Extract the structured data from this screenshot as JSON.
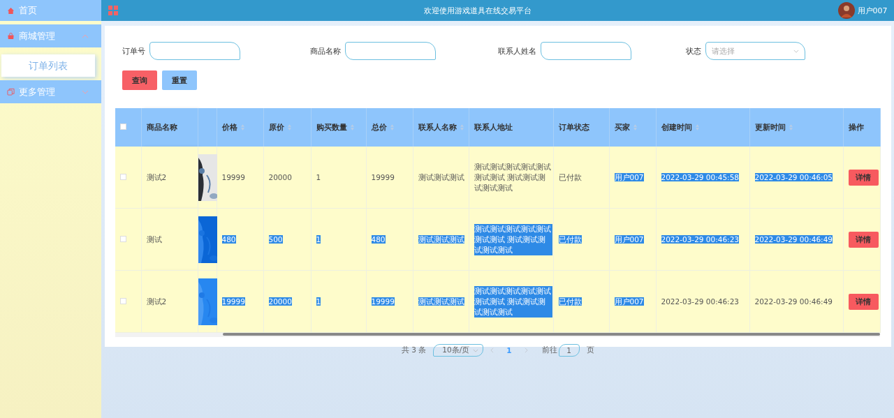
{
  "sidebar": {
    "items": [
      {
        "label": "首页",
        "kind": "home"
      },
      {
        "label": "商城管理",
        "kind": "shop",
        "expanded": true,
        "children": [
          {
            "label": "订单列表",
            "selected": true
          }
        ]
      },
      {
        "label": "更多管理",
        "kind": "more",
        "expanded": false
      }
    ]
  },
  "header": {
    "title": "欢迎使用游戏道具在线交易平台",
    "user": "用户007"
  },
  "filters": [
    {
      "label": "订单号",
      "kind": "input"
    },
    {
      "label": "商品名称",
      "kind": "input"
    },
    {
      "label": "联系人姓名",
      "kind": "input"
    },
    {
      "label": "状态",
      "kind": "select",
      "placeholder": "请选择"
    }
  ],
  "buttons": [
    {
      "label": "查询",
      "kind": "search"
    },
    {
      "label": "重置",
      "kind": "reset"
    }
  ],
  "table": {
    "all_checked": false,
    "columns": [
      {
        "label": "商品名称",
        "sortable": false
      },
      {
        "label": "价格",
        "sortable": true
      },
      {
        "label": "原价",
        "sortable": true
      },
      {
        "label": "购买数量",
        "sortable": true
      },
      {
        "label": "总价",
        "sortable": true
      },
      {
        "label": "联系人名称",
        "sortable": true
      },
      {
        "label": "联系人地址",
        "sortable": false
      },
      {
        "label": "订单状态",
        "sortable": false
      },
      {
        "label": "买家",
        "sortable": true
      },
      {
        "label": "创建时间",
        "sortable": true
      },
      {
        "label": "更新时间",
        "sortable": true
      },
      {
        "label": "操作",
        "sortable": false
      }
    ],
    "rows": [
      {
        "checked": false,
        "action": "详情",
        "cells": [
          {
            "text": "测试2",
            "highlighted": false
          },
          {
            "text": "19999",
            "highlighted": false
          },
          {
            "text": "20000",
            "highlighted": false
          },
          {
            "text": "1",
            "highlighted": false
          },
          {
            "text": "19999",
            "highlighted": false
          },
          {
            "text": "测试测试测试",
            "highlighted": false
          },
          {
            "text": "测试测试测试测试测试测试测试 测试测试测试测试测试",
            "highlighted": false
          },
          {
            "text": "已付款",
            "highlighted": false
          },
          {
            "text": "用户007",
            "highlighted": true
          },
          {
            "text": "2022-03-29 00:45:58",
            "highlighted": true
          },
          {
            "text": "2022-03-29 00:46:05",
            "highlighted": true
          }
        ]
      },
      {
        "checked": false,
        "action": "详情",
        "cells": [
          {
            "text": "测试",
            "highlighted": false
          },
          {
            "text": "480",
            "highlighted": true
          },
          {
            "text": "500",
            "highlighted": true
          },
          {
            "text": "1",
            "highlighted": true
          },
          {
            "text": "480",
            "highlighted": true
          },
          {
            "text": "测试测试测试",
            "highlighted": true
          },
          {
            "text": "测试测试测试测试测试测试测试 测试测试测试测试测试",
            "highlighted": true
          },
          {
            "text": "已付款",
            "highlighted": true
          },
          {
            "text": "用户007",
            "highlighted": true
          },
          {
            "text": "2022-03-29 00:46:23",
            "highlighted": true
          },
          {
            "text": "2022-03-29 00:46:49",
            "highlighted": true
          }
        ]
      },
      {
        "checked": false,
        "action": "详情",
        "cells": [
          {
            "text": "测试2",
            "highlighted": false
          },
          {
            "text": "19999",
            "highlighted": true
          },
          {
            "text": "20000",
            "highlighted": true
          },
          {
            "text": "1",
            "highlighted": true
          },
          {
            "text": "19999",
            "highlighted": true
          },
          {
            "text": "测试测试测试",
            "highlighted": true
          },
          {
            "text": "测试测试测试测试测试测试测试 测试测试测试测试测试",
            "highlighted": true
          },
          {
            "text": "已付款",
            "highlighted": true
          },
          {
            "text": "用户007",
            "highlighted": true
          },
          {
            "text": "2022-03-29 00:46:23",
            "highlighted": false
          },
          {
            "text": "2022-03-29 00:46:49",
            "highlighted": false
          }
        ]
      }
    ]
  },
  "pagination": {
    "total": "共 3 条",
    "page_size": "10条/页",
    "pages": [
      {
        "label": "1",
        "selected": true
      }
    ],
    "goto_label": "前往",
    "goto_value": "1",
    "goto_suffix": "页"
  }
}
